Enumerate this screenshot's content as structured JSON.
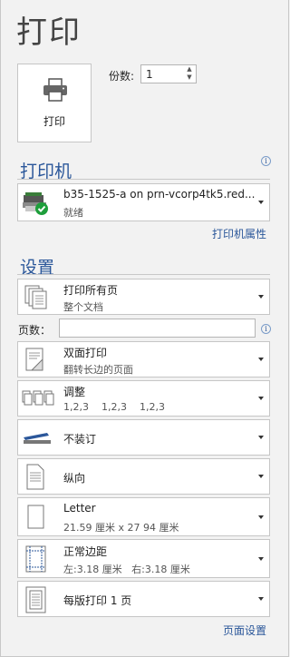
{
  "title": "打印",
  "print_button": {
    "label": "打印",
    "icon": "printer-icon"
  },
  "copies": {
    "label": "份数:",
    "value": "1"
  },
  "printer_section": {
    "heading": "打印机",
    "printer_name": "b35-1525-a on prn-vcorp4tk5.red...",
    "printer_status": "就绪",
    "properties_link": "打印机属性"
  },
  "settings_section": {
    "heading": "设置",
    "pages_label": "页数：",
    "pages_value": "",
    "print_range": {
      "title": "打印所有页",
      "subtitle": "整个文档"
    },
    "duplex": {
      "title": "双面打印",
      "subtitle": "翻转长边的页面"
    },
    "collate": {
      "title": "调整",
      "subtitle": "1,2,3    1,2,3    1,2,3"
    },
    "staple": {
      "title": "不装订"
    },
    "orientation": {
      "title": "纵向"
    },
    "paper": {
      "title": "Letter",
      "subtitle": "21.59 厘米 x 27 94 厘米"
    },
    "margins": {
      "title": "正常边距",
      "subtitle": "左:3.18 厘米   右:3.18 厘米"
    },
    "pages_per_sheet": {
      "title": "每版打印 1 页"
    },
    "page_setup_link": "页面设置"
  },
  "colors": {
    "accent": "#2b579a",
    "background": "#f2f2f2",
    "status_ok": "#1e9e3b"
  }
}
